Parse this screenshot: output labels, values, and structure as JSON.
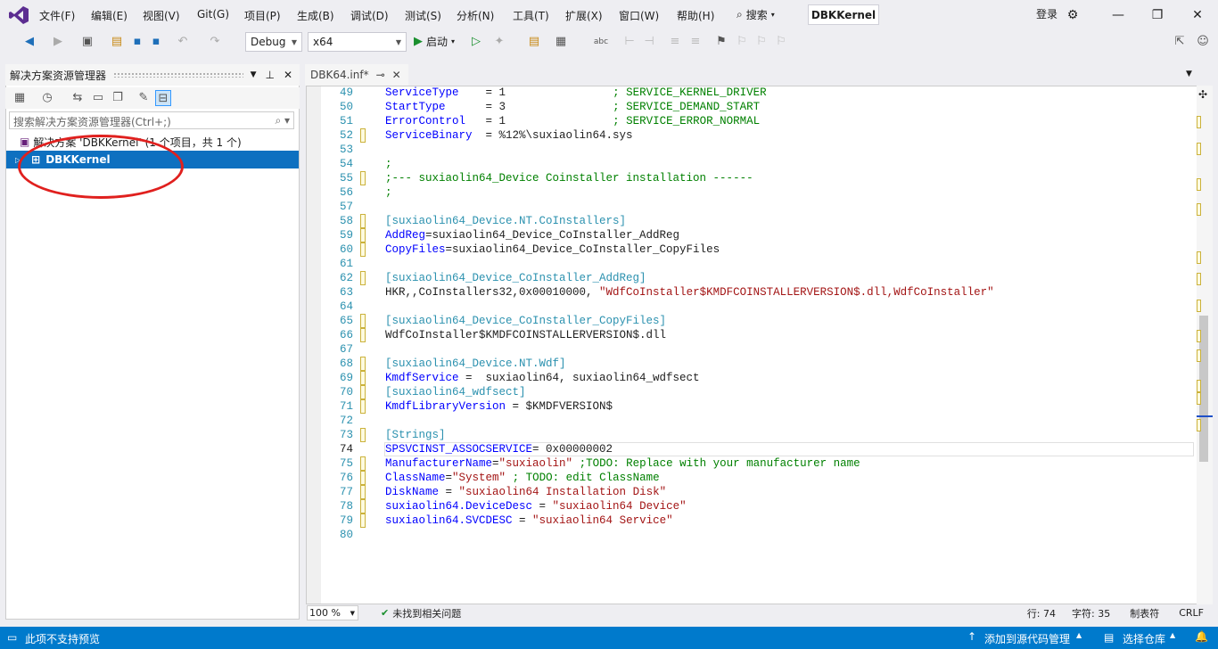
{
  "menu": {
    "items": [
      "文件(F)",
      "编辑(E)",
      "视图(V)",
      "Git(G)",
      "项目(P)",
      "生成(B)",
      "调试(D)",
      "测试(S)",
      "分析(N)",
      "工具(T)",
      "扩展(X)",
      "窗口(W)",
      "帮助(H)"
    ],
    "search_label": "搜索",
    "solution_name": "DBKKernel",
    "login": "登录"
  },
  "toolbar": {
    "config": "Debug",
    "platform": "x64",
    "start_label": "启动"
  },
  "solution_explorer": {
    "title": "解决方案资源管理器",
    "search_placeholder": "搜索解决方案资源管理器(Ctrl+;)",
    "solution_row": "解决方案 'DBKKernel' (1 个项目，共 1 个)",
    "project_row": "DBKKernel"
  },
  "editor": {
    "tab_label": "DBK64.inf*",
    "zoom": "100 %",
    "issues": "未找到相关问题",
    "row": "行: 74",
    "col": "字符: 35",
    "tabs_mode": "制表符",
    "line_ending": "CRLF",
    "lines": [
      {
        "n": "49",
        "parts": [
          [
            "k",
            "ServiceType    "
          ],
          [
            "t",
            "= 1                "
          ],
          [
            "c",
            "; SERVICE_KERNEL_DRIVER"
          ]
        ]
      },
      {
        "n": "50",
        "parts": [
          [
            "k",
            "StartType      "
          ],
          [
            "t",
            "= 3                "
          ],
          [
            "c",
            "; SERVICE_DEMAND_START"
          ]
        ]
      },
      {
        "n": "51",
        "parts": [
          [
            "k",
            "ErrorControl   "
          ],
          [
            "t",
            "= 1                "
          ],
          [
            "c",
            "; SERVICE_ERROR_NORMAL"
          ]
        ]
      },
      {
        "n": "52",
        "parts": [
          [
            "k",
            "ServiceBinary  "
          ],
          [
            "t",
            "= %12%\\suxiaolin64.sys"
          ]
        ]
      },
      {
        "n": "53",
        "parts": []
      },
      {
        "n": "54",
        "parts": [
          [
            "c",
            ";"
          ]
        ]
      },
      {
        "n": "55",
        "parts": [
          [
            "c",
            ";--- suxiaolin64_Device Coinstaller installation ------"
          ]
        ]
      },
      {
        "n": "56",
        "parts": [
          [
            "c",
            ";"
          ]
        ]
      },
      {
        "n": "57",
        "parts": []
      },
      {
        "n": "58",
        "parts": [
          [
            "s",
            "[suxiaolin64_Device.NT.CoInstallers]"
          ]
        ]
      },
      {
        "n": "59",
        "parts": [
          [
            "k",
            "AddReg"
          ],
          [
            "t",
            "=suxiaolin64_Device_CoInstaller_AddReg"
          ]
        ]
      },
      {
        "n": "60",
        "parts": [
          [
            "k",
            "CopyFiles"
          ],
          [
            "t",
            "=suxiaolin64_Device_CoInstaller_CopyFiles"
          ]
        ]
      },
      {
        "n": "61",
        "parts": []
      },
      {
        "n": "62",
        "parts": [
          [
            "s",
            "[suxiaolin64_Device_CoInstaller_AddReg]"
          ]
        ]
      },
      {
        "n": "63",
        "parts": [
          [
            "t",
            "HKR,,CoInstallers32,0x00010000, "
          ],
          [
            "r",
            "\"WdfCoInstaller$KMDFCOINSTALLERVERSION$.dll,WdfCoInstaller\""
          ]
        ]
      },
      {
        "n": "64",
        "parts": []
      },
      {
        "n": "65",
        "parts": [
          [
            "s",
            "[suxiaolin64_Device_CoInstaller_CopyFiles]"
          ]
        ]
      },
      {
        "n": "66",
        "parts": [
          [
            "t",
            "WdfCoInstaller$KMDFCOINSTALLERVERSION$.dll"
          ]
        ]
      },
      {
        "n": "67",
        "parts": []
      },
      {
        "n": "68",
        "parts": [
          [
            "s",
            "[suxiaolin64_Device.NT.Wdf]"
          ]
        ]
      },
      {
        "n": "69",
        "parts": [
          [
            "k",
            "KmdfService"
          ],
          [
            "t",
            " =  suxiaolin64, suxiaolin64_wdfsect"
          ]
        ]
      },
      {
        "n": "70",
        "parts": [
          [
            "s",
            "[suxiaolin64_wdfsect]"
          ]
        ]
      },
      {
        "n": "71",
        "parts": [
          [
            "k",
            "KmdfLibraryVersion"
          ],
          [
            "t",
            " = $KMDFVERSION$"
          ]
        ]
      },
      {
        "n": "72",
        "parts": []
      },
      {
        "n": "73",
        "parts": [
          [
            "s",
            "[Strings]"
          ]
        ]
      },
      {
        "n": "74",
        "parts": [
          [
            "k",
            "SPSVCINST_ASSOCSERVICE"
          ],
          [
            "t",
            "= 0x00000002"
          ]
        ]
      },
      {
        "n": "75",
        "parts": [
          [
            "k",
            "ManufacturerName"
          ],
          [
            "t",
            "="
          ],
          [
            "r",
            "\"suxiaolin\""
          ],
          [
            "t",
            " "
          ],
          [
            "c",
            ";TODO: Replace with your manufacturer name"
          ]
        ]
      },
      {
        "n": "76",
        "parts": [
          [
            "k",
            "ClassName"
          ],
          [
            "t",
            "="
          ],
          [
            "r",
            "\"System\""
          ],
          [
            "t",
            " "
          ],
          [
            "c",
            "; TODO: edit ClassName"
          ]
        ]
      },
      {
        "n": "77",
        "parts": [
          [
            "k",
            "DiskName"
          ],
          [
            "t",
            " = "
          ],
          [
            "r",
            "\"suxiaolin64 Installation Disk\""
          ]
        ]
      },
      {
        "n": "78",
        "parts": [
          [
            "k",
            "suxiaolin64.DeviceDesc"
          ],
          [
            "t",
            " = "
          ],
          [
            "r",
            "\"suxiaolin64 Device\""
          ]
        ]
      },
      {
        "n": "79",
        "parts": [
          [
            "k",
            "suxiaolin64.SVCDESC"
          ],
          [
            "t",
            " = "
          ],
          [
            "r",
            "\"suxiaolin64 Service\""
          ]
        ]
      },
      {
        "n": "80",
        "parts": []
      }
    ],
    "current_line": "74"
  },
  "statusbar": {
    "left": "此项不支持预览",
    "add_source": "添加到源代码管理",
    "select_repo": "选择仓库"
  },
  "colors": {
    "accent": "#007acc",
    "selection": "#0e70c0",
    "annotation": "#e0201e"
  }
}
